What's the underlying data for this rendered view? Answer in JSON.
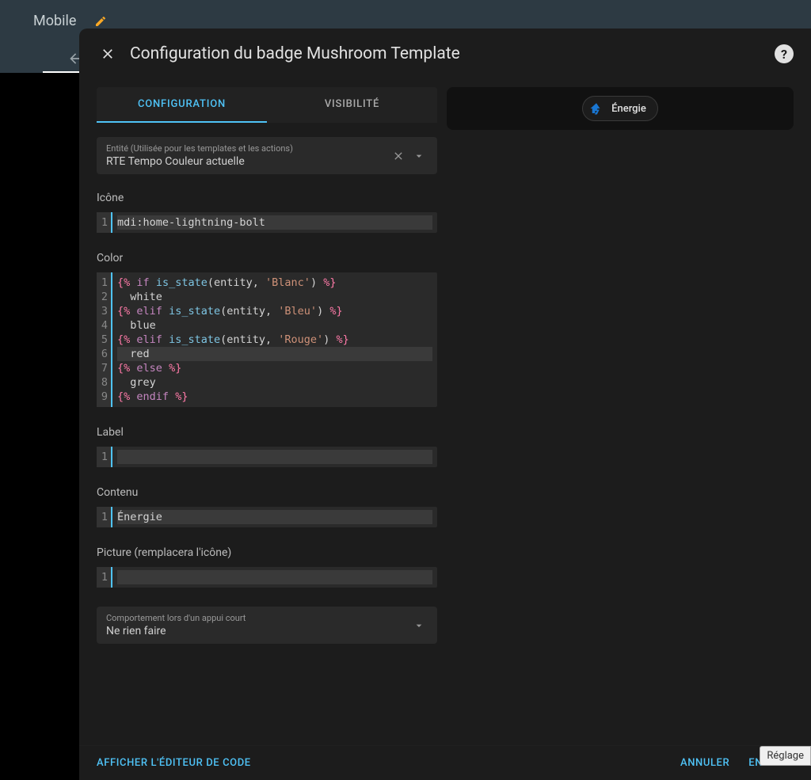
{
  "topbar": {
    "title": "Mobile"
  },
  "dialog": {
    "title": "Configuration du badge Mushroom Template"
  },
  "tabs": {
    "config": "CONFIGURATION",
    "visibility": "VISIBILITÉ"
  },
  "entity": {
    "label": "Entité (Utilisée pour les templates et les actions)",
    "value": "RTE Tempo Couleur actuelle"
  },
  "sections": {
    "icon_label": "Icône",
    "icon_code": "mdi:home-lightning-bolt",
    "color_label": "Color",
    "color_lines": [
      [
        {
          "c": "tok-tag",
          "t": "{%"
        },
        {
          "c": "",
          "t": " "
        },
        {
          "c": "tok-kw",
          "t": "if"
        },
        {
          "c": "",
          "t": " "
        },
        {
          "c": "tok-fn",
          "t": "is_state"
        },
        {
          "c": "tok-par",
          "t": "("
        },
        {
          "c": "tok-var",
          "t": "entity"
        },
        {
          "c": "tok-par",
          "t": ", "
        },
        {
          "c": "tok-str",
          "t": "'Blanc'"
        },
        {
          "c": "tok-par",
          "t": ")"
        },
        {
          "c": "",
          "t": " "
        },
        {
          "c": "tok-tag",
          "t": "%}"
        }
      ],
      [
        {
          "c": "tok-txt",
          "t": "  white"
        }
      ],
      [
        {
          "c": "tok-tag",
          "t": "{%"
        },
        {
          "c": "",
          "t": " "
        },
        {
          "c": "tok-kw",
          "t": "elif"
        },
        {
          "c": "",
          "t": " "
        },
        {
          "c": "tok-fn",
          "t": "is_state"
        },
        {
          "c": "tok-par",
          "t": "("
        },
        {
          "c": "tok-var",
          "t": "entity"
        },
        {
          "c": "tok-par",
          "t": ", "
        },
        {
          "c": "tok-str",
          "t": "'Bleu'"
        },
        {
          "c": "tok-par",
          "t": ")"
        },
        {
          "c": "",
          "t": " "
        },
        {
          "c": "tok-tag",
          "t": "%}"
        }
      ],
      [
        {
          "c": "tok-txt",
          "t": "  blue"
        }
      ],
      [
        {
          "c": "tok-tag",
          "t": "{%"
        },
        {
          "c": "",
          "t": " "
        },
        {
          "c": "tok-kw",
          "t": "elif"
        },
        {
          "c": "",
          "t": " "
        },
        {
          "c": "tok-fn",
          "t": "is_state"
        },
        {
          "c": "tok-par",
          "t": "("
        },
        {
          "c": "tok-var",
          "t": "entity"
        },
        {
          "c": "tok-par",
          "t": ", "
        },
        {
          "c": "tok-str",
          "t": "'Rouge'"
        },
        {
          "c": "tok-par",
          "t": ")"
        },
        {
          "c": "",
          "t": " "
        },
        {
          "c": "tok-tag",
          "t": "%}"
        }
      ],
      [
        {
          "c": "tok-txt",
          "t": "  red"
        }
      ],
      [
        {
          "c": "tok-tag",
          "t": "{%"
        },
        {
          "c": "",
          "t": " "
        },
        {
          "c": "tok-kw",
          "t": "else"
        },
        {
          "c": "",
          "t": " "
        },
        {
          "c": "tok-tag",
          "t": "%}"
        }
      ],
      [
        {
          "c": "tok-txt",
          "t": "  grey"
        }
      ],
      [
        {
          "c": "tok-tag",
          "t": "{%"
        },
        {
          "c": "",
          "t": " "
        },
        {
          "c": "tok-kw",
          "t": "endif"
        },
        {
          "c": "",
          "t": " "
        },
        {
          "c": "tok-tag",
          "t": "%}"
        }
      ]
    ],
    "color_hl": [
      5
    ],
    "label_label": "Label",
    "label_code": "",
    "content_label": "Contenu",
    "content_code": "Énergie",
    "picture_label": "Picture (remplacera l'icône)",
    "picture_code": ""
  },
  "tap_action": {
    "label": "Comportement lors d'un appui court",
    "value": "Ne rien faire"
  },
  "preview": {
    "chip_label": "Énergie"
  },
  "footer": {
    "code_editor": "AFFICHER L'ÉDITEUR DE CODE",
    "cancel": "ANNULER",
    "save": "ENREGIS"
  },
  "tooltip": "Réglage"
}
